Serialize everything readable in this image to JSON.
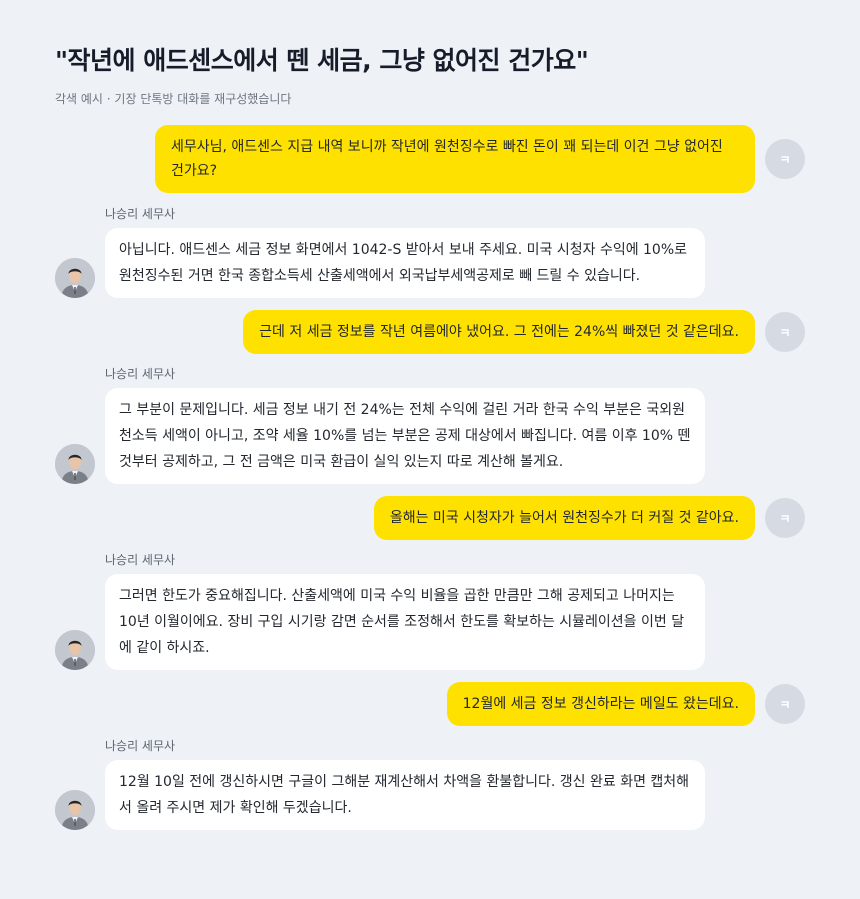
{
  "header": {
    "title": "\"작년에 애드센스에서 뗀 세금, 그냥 없어진 건가요\"",
    "subtitle": "각색 예시 · 기장 단톡방 대화를 재구성했습니다"
  },
  "user": {
    "avatar_initial": "ㅋ"
  },
  "advisor": {
    "name": "나승리 세무사",
    "avatar_icon": "advisor-portrait"
  },
  "messages": [
    {
      "from": "user",
      "text": "세무사님, 애드센스 지급 내역 보니까 작년에 원천징수로 빠진 돈이 꽤 되는데 이건 그냥 없어진 건가요?"
    },
    {
      "from": "advisor",
      "text": "아닙니다. 애드센스 세금 정보 화면에서 1042-S 받아서 보내 주세요. 미국 시청자 수익에 10%로 원천징수된 거면 한국 종합소득세 산출세액에서 외국납부세액공제로 빼 드릴 수 있습니다."
    },
    {
      "from": "user",
      "text": "근데 저 세금 정보를 작년 여름에야 냈어요. 그 전에는 24%씩 빠졌던 것 같은데요."
    },
    {
      "from": "advisor",
      "text": "그 부분이 문제입니다. 세금 정보 내기 전 24%는 전체 수익에 걸린 거라 한국 수익 부분은 국외원천소득 세액이 아니고, 조약 세율 10%를 넘는 부분은 공제 대상에서 빠집니다. 여름 이후 10% 뗀 것부터 공제하고, 그 전 금액은 미국 환급이 실익 있는지 따로 계산해 볼게요."
    },
    {
      "from": "user",
      "text": "올해는 미국 시청자가 늘어서 원천징수가 더 커질 것 같아요."
    },
    {
      "from": "advisor",
      "text": "그러면 한도가 중요해집니다. 산출세액에 미국 수익 비율을 곱한 만큼만 그해 공제되고 나머지는 10년 이월이에요. 장비 구입 시기랑 감면 순서를 조정해서 한도를 확보하는 시뮬레이션을 이번 달에 같이 하시죠."
    },
    {
      "from": "user",
      "text": "12월에 세금 정보 갱신하라는 메일도 왔는데요."
    },
    {
      "from": "advisor",
      "text": "12월 10일 전에 갱신하시면 구글이 그해분 재계산해서 차액을 환불합니다. 갱신 완료 화면 캡처해서 올려 주시면 제가 확인해 두겠습니다."
    }
  ],
  "colors": {
    "background": "#EEF1F6",
    "user_bubble": "#FFE100",
    "advisor_bubble": "#FFFFFF",
    "user_avatar": "#D5DAE3"
  }
}
